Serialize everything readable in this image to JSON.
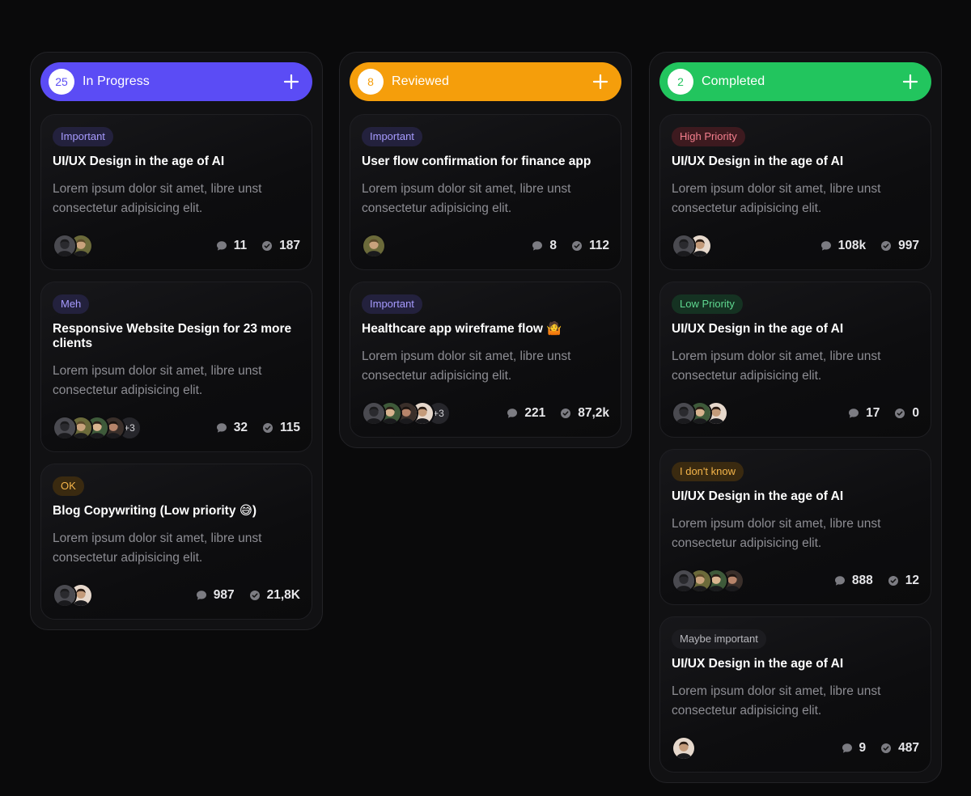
{
  "colors": {
    "in_progress": "#5b4cf5",
    "reviewed": "#f59e0b",
    "completed": "#22c55e"
  },
  "columns": [
    {
      "id": "in_progress",
      "title": "In Progress",
      "count": "25",
      "color": "#5b4cf5",
      "add_icon": "plus-icon",
      "cards": [
        {
          "tag": "Important",
          "title": "UI/UX Design in the age of AI",
          "description": "Lorem ipsum dolor sit amet, libre unst consectetur adipisicing elit.",
          "avatars": [
            "person-a",
            "person-b"
          ],
          "more": "",
          "comments": "11",
          "checks": "187"
        },
        {
          "tag": "Meh",
          "title": "Responsive Website Design for 23 more clients",
          "description": "Lorem ipsum dolor sit amet, libre unst consectetur adipisicing elit.",
          "avatars": [
            "person-a",
            "person-b",
            "person-c",
            "person-d"
          ],
          "more": "+3",
          "comments": "32",
          "checks": "115"
        },
        {
          "tag": "OK",
          "title": "Blog Copywriting (Low priority 😅)",
          "description": "Lorem ipsum dolor sit amet, libre unst consectetur adipisicing elit.",
          "avatars": [
            "person-a",
            "person-e"
          ],
          "more": "",
          "comments": "987",
          "checks": "21,8K"
        }
      ]
    },
    {
      "id": "reviewed",
      "title": "Reviewed",
      "count": "8",
      "color": "#f59e0b",
      "add_icon": "plus-icon",
      "cards": [
        {
          "tag": "Important",
          "title": "User flow confirmation for finance app",
          "description": "Lorem ipsum dolor sit amet, libre unst consectetur adipisicing elit.",
          "avatars": [
            "person-b"
          ],
          "more": "",
          "comments": "8",
          "checks": "112"
        },
        {
          "tag": "Important",
          "title": "Healthcare app wireframe flow 🤷",
          "description": "Lorem ipsum dolor sit amet, libre unst consectetur adipisicing elit.",
          "avatars": [
            "person-a",
            "person-c",
            "person-d",
            "person-e"
          ],
          "more": "+3",
          "comments": "221",
          "checks": "87,2k"
        }
      ]
    },
    {
      "id": "completed",
      "title": "Completed",
      "count": "2",
      "color": "#22c55e",
      "add_icon": "plus-icon",
      "cards": [
        {
          "tag": "High Priority",
          "title": "UI/UX Design in the age of AI",
          "description": "Lorem ipsum dolor sit amet, libre unst consectetur adipisicing elit.",
          "avatars": [
            "person-a",
            "person-e"
          ],
          "more": "",
          "comments": "108k",
          "checks": "997"
        },
        {
          "tag": "Low Priority",
          "title": "UI/UX Design in the age of AI",
          "description": "Lorem ipsum dolor sit amet, libre unst consectetur adipisicing elit.",
          "avatars": [
            "person-a",
            "person-c",
            "person-e"
          ],
          "more": "",
          "comments": "17",
          "checks": "0"
        },
        {
          "tag": "I don't know",
          "title": "UI/UX Design in the age of AI",
          "description": "Lorem ipsum dolor sit amet, libre unst consectetur adipisicing elit.",
          "avatars": [
            "person-a",
            "person-b",
            "person-c",
            "person-d"
          ],
          "more": "",
          "comments": "888",
          "checks": "12"
        },
        {
          "tag": "Maybe important",
          "title": "UI/UX Design in the age of AI",
          "description": "Lorem ipsum dolor sit amet, libre unst consectetur adipisicing elit.",
          "avatars": [
            "person-e"
          ],
          "more": "",
          "comments": "9",
          "checks": "487"
        }
      ]
    }
  ],
  "tag_styles": {
    "Important": {
      "bg": "#23213d",
      "fg": "#a79bff"
    },
    "Meh": {
      "bg": "#23213d",
      "fg": "#a79bff"
    },
    "OK": {
      "bg": "#3a2a10",
      "fg": "#f5b54a"
    },
    "High Priority": {
      "bg": "#3d1a1f",
      "fg": "#f57f8e"
    },
    "Low Priority": {
      "bg": "#153222",
      "fg": "#5fd890"
    },
    "I don't know": {
      "bg": "#3a2a10",
      "fg": "#f5b54a"
    },
    "Maybe important": {
      "bg": "#1c1c20",
      "fg": "#b9b9be"
    }
  },
  "icons": {
    "comment": "comment-icon",
    "check": "check-circle-icon"
  }
}
